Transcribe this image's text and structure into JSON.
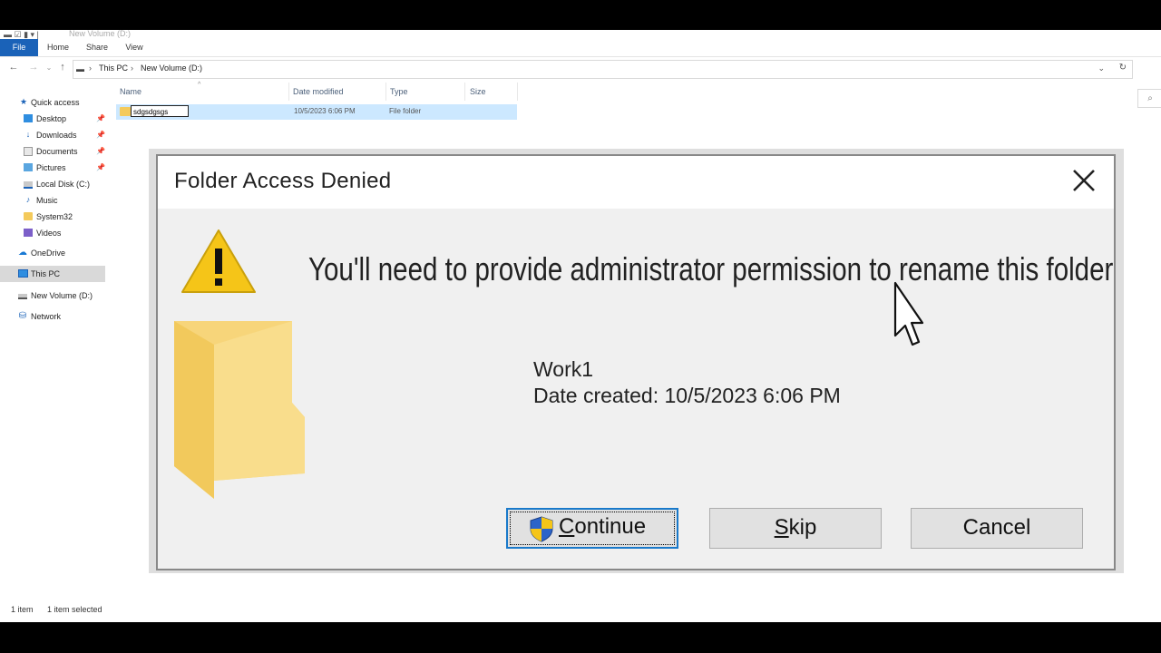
{
  "window": {
    "title": "New Volume (D:)"
  },
  "ribbon": {
    "tabs": [
      {
        "label": "File"
      },
      {
        "label": "Home"
      },
      {
        "label": "Share"
      },
      {
        "label": "View"
      }
    ]
  },
  "address": {
    "crumbs": [
      "This PC",
      "New Volume (D:)"
    ],
    "separator": ">"
  },
  "navigation": {
    "items": [
      {
        "label": "Quick access",
        "icon": "star-icon"
      },
      {
        "label": "Desktop",
        "icon": "desktop-icon",
        "pinned": true
      },
      {
        "label": "Downloads",
        "icon": "download-icon",
        "pinned": true
      },
      {
        "label": "Documents",
        "icon": "document-icon",
        "pinned": true
      },
      {
        "label": "Pictures",
        "icon": "picture-icon",
        "pinned": true
      },
      {
        "label": "Local Disk (C:)",
        "icon": "drive-icon"
      },
      {
        "label": "Music",
        "icon": "music-icon"
      },
      {
        "label": "System32",
        "icon": "folder-icon"
      },
      {
        "label": "Videos",
        "icon": "video-icon"
      },
      {
        "label": "OneDrive",
        "icon": "cloud-icon"
      },
      {
        "label": "This PC",
        "icon": "pc-icon",
        "selected": true
      },
      {
        "label": "New Volume (D:)",
        "icon": "drive-icon"
      },
      {
        "label": "Network",
        "icon": "network-icon"
      }
    ]
  },
  "columns": [
    "Name",
    "Date modified",
    "Type",
    "Size"
  ],
  "files": [
    {
      "name": "sdgsdgsgs",
      "date_modified": "10/5/2023 6:06 PM",
      "type": "File folder",
      "size": ""
    }
  ],
  "status": {
    "count": "1 item",
    "selected": "1 item selected"
  },
  "dialog": {
    "title": "Folder Access Denied",
    "message": "You'll need to provide administrator permission to rename this folder",
    "item_name": "Work1",
    "item_date": "Date created: 10/5/2023 6:06 PM",
    "buttons": {
      "continue": "Continue",
      "skip": "Skip",
      "cancel": "Cancel"
    }
  },
  "colors": {
    "accent": "#1a62b8",
    "selection": "#cce8ff",
    "warning": "#f5c518",
    "folder": "#f4ca5b"
  }
}
